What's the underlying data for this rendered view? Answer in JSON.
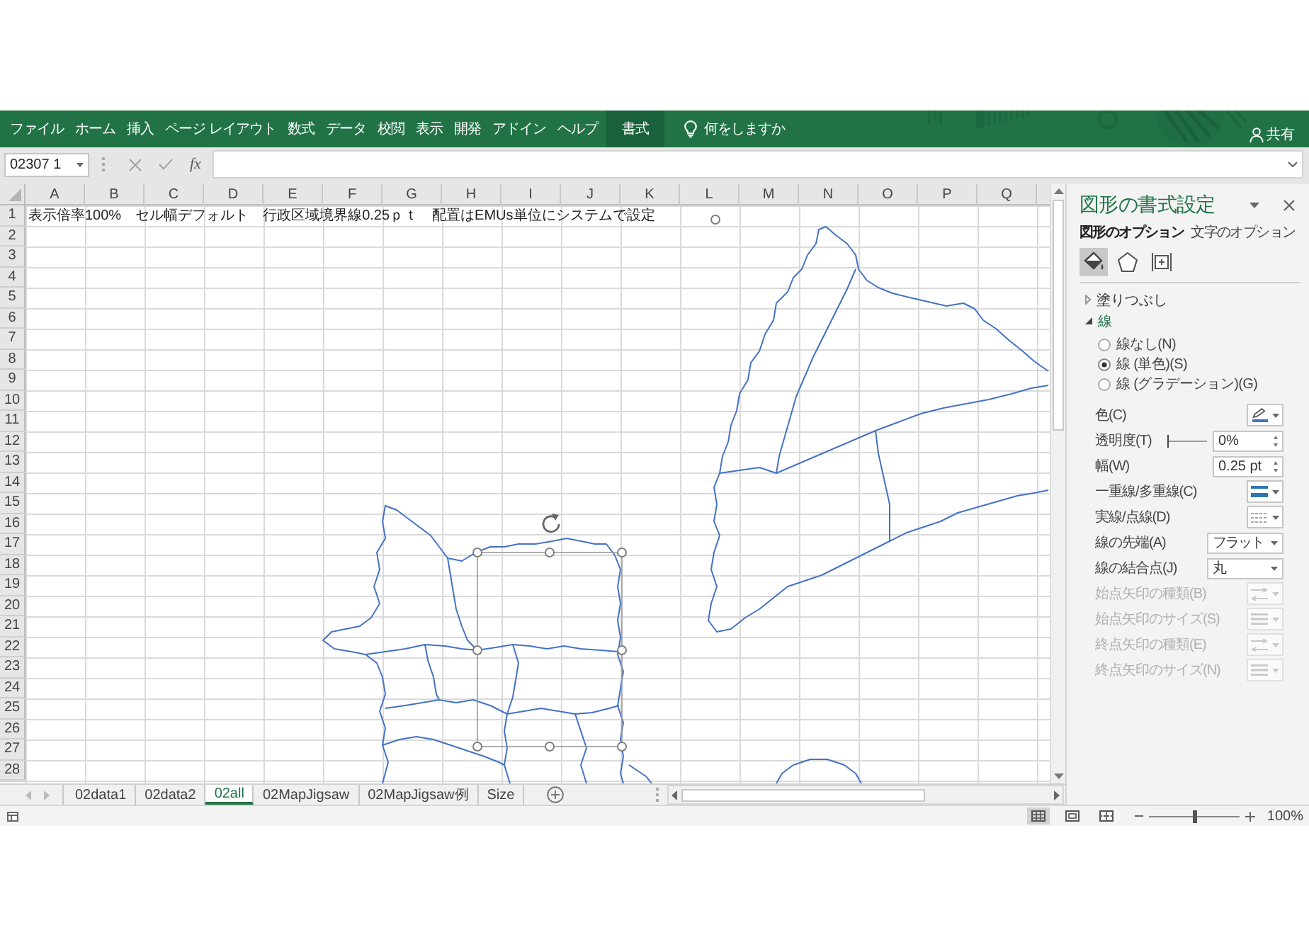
{
  "ribbon": {
    "tabs": [
      {
        "label": "ファイル",
        "selected": false
      },
      {
        "label": "ホーム",
        "selected": false
      },
      {
        "label": "挿入",
        "selected": false
      },
      {
        "label": "ページ レイアウト",
        "selected": false
      },
      {
        "label": "数式",
        "selected": false
      },
      {
        "label": "データ",
        "selected": false
      },
      {
        "label": "校閲",
        "selected": false
      },
      {
        "label": "表示",
        "selected": false
      },
      {
        "label": "開発",
        "selected": false
      },
      {
        "label": "アドイン",
        "selected": false
      },
      {
        "label": "ヘルプ",
        "selected": false
      },
      {
        "label": "書式",
        "selected": true
      }
    ],
    "search": {
      "placeholder": "何をしますか"
    },
    "share": {
      "label": "共有"
    }
  },
  "formula_bar": {
    "name_box": "02307 1",
    "function_button": "fx"
  },
  "sheet": {
    "columns": [
      "A",
      "B",
      "C",
      "D",
      "E",
      "F",
      "G",
      "H",
      "I",
      "J",
      "K",
      "L",
      "M",
      "N",
      "O",
      "P",
      "Q"
    ],
    "rows": [
      "1",
      "2",
      "3",
      "4",
      "5",
      "6",
      "7",
      "8",
      "9",
      "10",
      "11",
      "12",
      "13",
      "14",
      "15",
      "16",
      "17",
      "18",
      "19",
      "20",
      "21",
      "22",
      "23",
      "24",
      "25",
      "26",
      "27",
      "28"
    ],
    "cell_text": "表示倍率100%　セル幅デフォルト　行政区域境界線0.25ｐｔ　配置はEMUs単位にシステムで設定"
  },
  "sheet_tabs": [
    {
      "label": "02data1",
      "selected": false
    },
    {
      "label": "02data2",
      "selected": false
    },
    {
      "label": "02all",
      "selected": true
    },
    {
      "label": "02MapJigsaw",
      "selected": false
    },
    {
      "label": "02MapJigsaw例",
      "selected": false
    },
    {
      "label": "Size",
      "selected": false
    }
  ],
  "format_pane": {
    "title": "図形の書式設定",
    "tabs": [
      {
        "label": "図形のオプション",
        "selected": true
      },
      {
        "label": "文字のオプション",
        "selected": false
      }
    ],
    "categories": [
      {
        "kind": "fill_line",
        "selected": true
      },
      {
        "kind": "effects",
        "selected": false
      },
      {
        "kind": "size",
        "selected": false
      }
    ],
    "sections": [
      {
        "label": "塗りつぶし",
        "expanded": false
      },
      {
        "label": "線",
        "expanded": true,
        "line_types": [
          {
            "label": "線なし(N)",
            "selected": false
          },
          {
            "label": "線 (単色)(S)",
            "selected": true
          },
          {
            "label": "線 (グラデーション)(G)",
            "selected": false
          }
        ],
        "properties": [
          {
            "kind": "color",
            "label": "色(C)",
            "color": "#4472c4",
            "disabled": false
          },
          {
            "kind": "slider",
            "label": "透明度(T)",
            "level": 0,
            "value": "0%",
            "disabled": false
          },
          {
            "kind": "spin",
            "label": "幅(W)",
            "value": "0.25 pt",
            "disabled": false
          },
          {
            "kind": "compound",
            "label": "一重線/多重線(C)",
            "disabled": false
          },
          {
            "kind": "dash",
            "label": "実線/点線(D)",
            "disabled": false
          },
          {
            "kind": "select",
            "label": "線の先端(A)",
            "value": "フラット",
            "disabled": false
          },
          {
            "kind": "select",
            "label": "線の結合点(J)",
            "value": "丸",
            "disabled": false
          },
          {
            "kind": "arrow_type",
            "label": "始点矢印の種類(B)",
            "disabled": true
          },
          {
            "kind": "arrow_size",
            "label": "始点矢印のサイズ(S)",
            "disabled": true
          },
          {
            "kind": "arrow_type",
            "label": "終点矢印の種類(E)",
            "disabled": true
          },
          {
            "kind": "arrow_size",
            "label": "終点矢印のサイズ(N)",
            "disabled": true
          }
        ]
      }
    ]
  },
  "status_bar": {
    "views": [
      {
        "kind": "normal",
        "selected": true
      },
      {
        "kind": "page_layout",
        "selected": false
      },
      {
        "kind": "page_break",
        "selected": false
      }
    ],
    "zoom": {
      "level": 0.5,
      "label": "100%"
    }
  }
}
